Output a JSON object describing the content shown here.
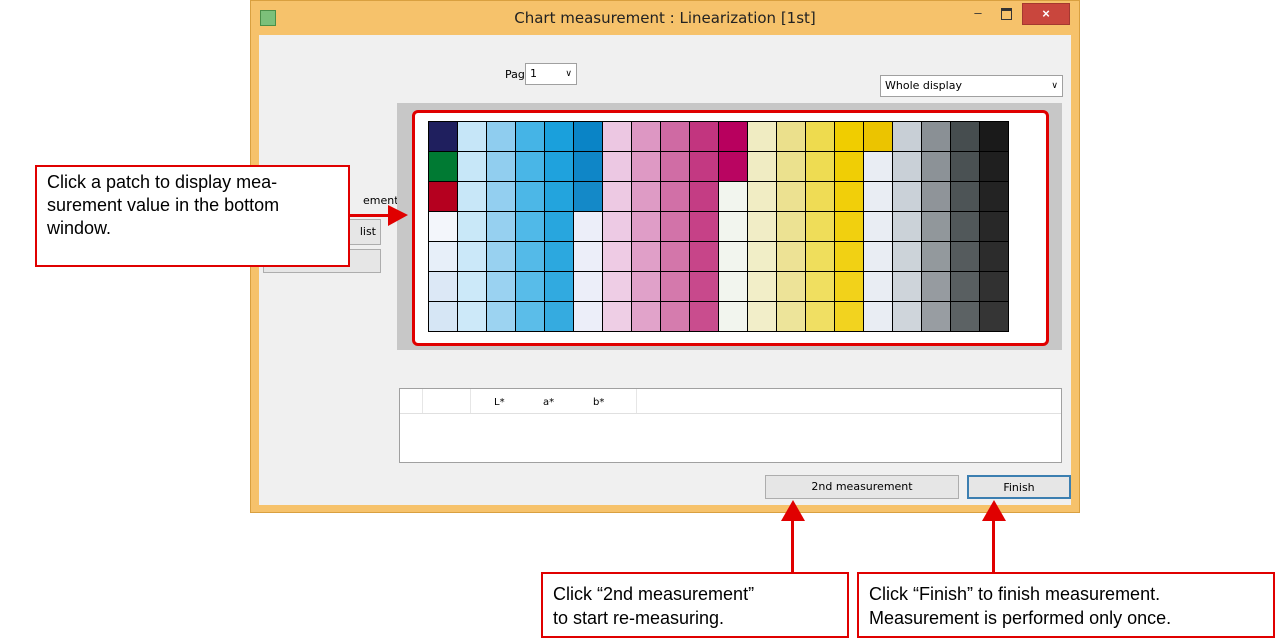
{
  "window": {
    "title": "Chart measurement : Linearization [1st]",
    "minimize": "–",
    "close": "×"
  },
  "page_selector": {
    "label": "Page",
    "value": "1"
  },
  "view_selector": {
    "value": "Whole display"
  },
  "left_panel": {
    "frag1": "ement",
    "frag2": "list"
  },
  "results_table": {
    "columns": [
      "",
      "",
      "L*",
      "a*",
      "b*"
    ]
  },
  "buttons": {
    "second": "2nd measurement",
    "finish": "Finish"
  },
  "callouts": {
    "patch": "Click a patch to display mea-\nsurement value in the bottom\nwindow.",
    "second": "Click “2nd measurement”\nto start re-measuring.",
    "finish": "Click “Finish” to finish measurement.\nMeasurement is performed only once."
  },
  "colors": {
    "accent_red": "#e00000",
    "window_border": "#f6c26b",
    "columns": [
      "#1f1f5e",
      "#c6e6f8",
      "#8fcdef",
      "#45b4e6",
      "#1aa0dc",
      "#0a84c6",
      "#ecc7e2",
      "#dd97c3",
      "#cf6aa3",
      "#c2357f",
      "#b8005e",
      "#f0ecc2",
      "#ebe08c",
      "#eedb4e",
      "#f0cd00",
      "#ebc400",
      "#c8cfd6",
      "#8a9095",
      "#464d4f",
      "#1a1a1a"
    ]
  }
}
